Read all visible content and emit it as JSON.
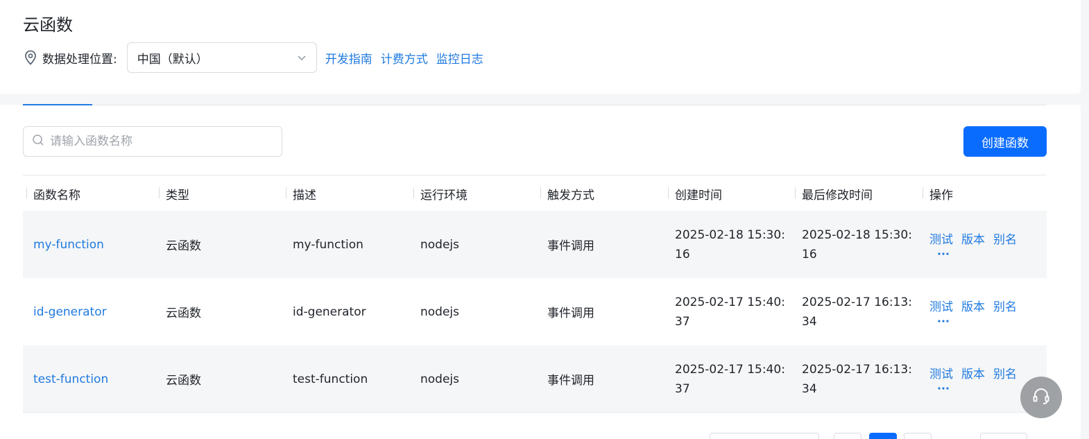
{
  "header": {
    "title": "云函数",
    "location_label": "数据处理位置:",
    "region_selected": "中国（默认）",
    "links": [
      "开发指南",
      "计费方式",
      "监控日志"
    ]
  },
  "toolbar": {
    "search_placeholder": "请输入函数名称",
    "create_label": "创建函数"
  },
  "table": {
    "columns": [
      "函数名称",
      "类型",
      "描述",
      "运行环境",
      "触发方式",
      "创建时间",
      "最后修改时间",
      "操作"
    ],
    "rows": [
      {
        "name": "my-function",
        "type": "云函数",
        "desc": "my-function",
        "runtime": "nodejs",
        "trigger": "事件调用",
        "created_1": "2025-02-18 15:30:",
        "created_2": "16",
        "modified_1": "2025-02-18 15:30:",
        "modified_2": "16"
      },
      {
        "name": "id-generator",
        "type": "云函数",
        "desc": "id-generator",
        "runtime": "nodejs",
        "trigger": "事件调用",
        "created_1": "2025-02-17 15:40:",
        "created_2": "37",
        "modified_1": "2025-02-17 16:13:",
        "modified_2": "34"
      },
      {
        "name": "test-function",
        "type": "云函数",
        "desc": "test-function",
        "runtime": "nodejs",
        "trigger": "事件调用",
        "created_1": "2025-02-17 15:40:",
        "created_2": "37",
        "modified_1": "2025-02-17 16:13:",
        "modified_2": "34"
      }
    ],
    "actions": [
      "测试",
      "版本",
      "别名"
    ]
  },
  "colors": {
    "accent": "#0a6cff",
    "link": "#1f7ae0"
  },
  "icons": {
    "location": "map-pin-icon",
    "search": "search-icon",
    "dropdown": "chevron-down-icon",
    "more": "more-dots-icon",
    "help": "headset-icon"
  }
}
